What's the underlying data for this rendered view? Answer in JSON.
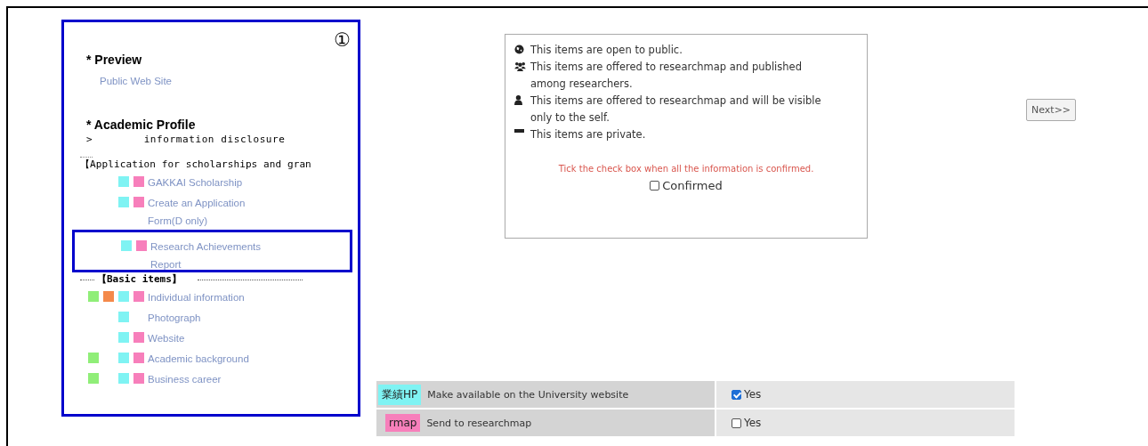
{
  "sidebar": {
    "badge": "①",
    "marker_columns": [
      {
        "color": "#90ee78"
      },
      {
        "color": "#f4894a"
      },
      {
        "color": "#7ff3f3"
      },
      {
        "color": "#f77fbb"
      }
    ],
    "items": [
      {
        "kind": "heading",
        "label": "* Preview"
      },
      {
        "kind": "link",
        "label": "Public Web Site"
      },
      {
        "kind": "heading",
        "label": "* Academic Profile"
      },
      {
        "kind": "toggle",
        "icon": ">",
        "label": "information disclosure"
      },
      {
        "kind": "group",
        "label": "【Application for scholarships and gran"
      },
      {
        "kind": "item",
        "label": "GAKKAI Scholarship",
        "highlighted": false,
        "markers": [
          false,
          false,
          true,
          true
        ]
      },
      {
        "kind": "item",
        "label": "Create an Application Form(D only)",
        "highlighted": false,
        "markers": [
          false,
          false,
          true,
          true
        ]
      },
      {
        "kind": "item",
        "label": "Research Achievements Report",
        "highlighted": true,
        "markers": [
          false,
          false,
          true,
          true
        ]
      },
      {
        "kind": "section",
        "label": "【Basic items】"
      },
      {
        "kind": "item",
        "label": "Individual information",
        "highlighted": false,
        "markers": [
          true,
          true,
          true,
          true
        ]
      },
      {
        "kind": "item",
        "label": "Photograph",
        "highlighted": false,
        "markers": [
          false,
          false,
          true,
          false
        ]
      },
      {
        "kind": "item",
        "label": "Website",
        "highlighted": false,
        "markers": [
          false,
          false,
          true,
          true
        ]
      },
      {
        "kind": "item",
        "label": "Academic background",
        "highlighted": false,
        "markers": [
          true,
          false,
          true,
          true
        ]
      },
      {
        "kind": "item",
        "label": "Business career",
        "highlighted": false,
        "markers": [
          true,
          false,
          true,
          true
        ]
      }
    ]
  },
  "legend": {
    "entries": [
      {
        "kind": "globe",
        "text": "This items are open to public."
      },
      {
        "kind": "users",
        "text": "This items are offered to researchmap and published among researchers."
      },
      {
        "kind": "user",
        "text": "This items are offered to researchmap and will be visible only to the self."
      },
      {
        "kind": "minus",
        "text": "This items are private."
      }
    ],
    "notice": "Tick the check box when all the information is confirmed.",
    "confirm": {
      "label": "Confirmed",
      "checked": false
    }
  },
  "next_button": "Next>>",
  "publish_table": {
    "rows": [
      {
        "tag": "業績HP",
        "color": "#7ff3f3",
        "description": "Make available on the University website",
        "option": "Yes",
        "checked": true
      },
      {
        "tag": "rmap",
        "color": "#f77fbb",
        "description": "Send to researchmap",
        "option": "Yes",
        "checked": false
      }
    ]
  }
}
